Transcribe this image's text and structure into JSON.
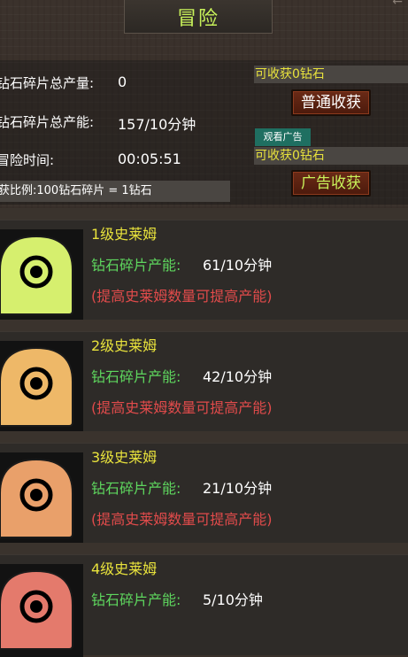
{
  "header": {
    "title": "冒险",
    "corner": "←"
  },
  "stats": {
    "total_output_label": "钻石碎片总产量:",
    "total_output_value": "0",
    "total_rate_label": "钻石碎片总产能:",
    "total_rate_value": "157/10分钟",
    "adventure_time_label": "冒险时间:",
    "adventure_time_value": "00:05:51",
    "ratio_text": "获比例:100钻石碎片 = 1钻石"
  },
  "claims": {
    "normal_available": "可收获0钻石",
    "normal_button": "普通收获",
    "ad_tag": "观看广告",
    "ad_available": "可收获0钻石",
    "ad_button": "广告收获"
  },
  "cards": [
    {
      "title": "1级史莱姆",
      "rate_label": "钻石碎片产能:",
      "rate_value": "61/10分钟",
      "hint": "(提高史莱姆数量可提高产能)",
      "color": "#d6ef6e"
    },
    {
      "title": "2级史莱姆",
      "rate_label": "钻石碎片产能:",
      "rate_value": "42/10分钟",
      "hint": "(提高史莱姆数量可提高产能)",
      "color": "#eeb868"
    },
    {
      "title": "3级史莱姆",
      "rate_label": "钻石碎片产能:",
      "rate_value": "21/10分钟",
      "hint": "(提高史莱姆数量可提高产能)",
      "color": "#e9a06a"
    },
    {
      "title": "4级史莱姆",
      "rate_label": "钻石碎片产能:",
      "rate_value": "5/10分钟",
      "hint": "",
      "color": "#e47a6c"
    }
  ]
}
